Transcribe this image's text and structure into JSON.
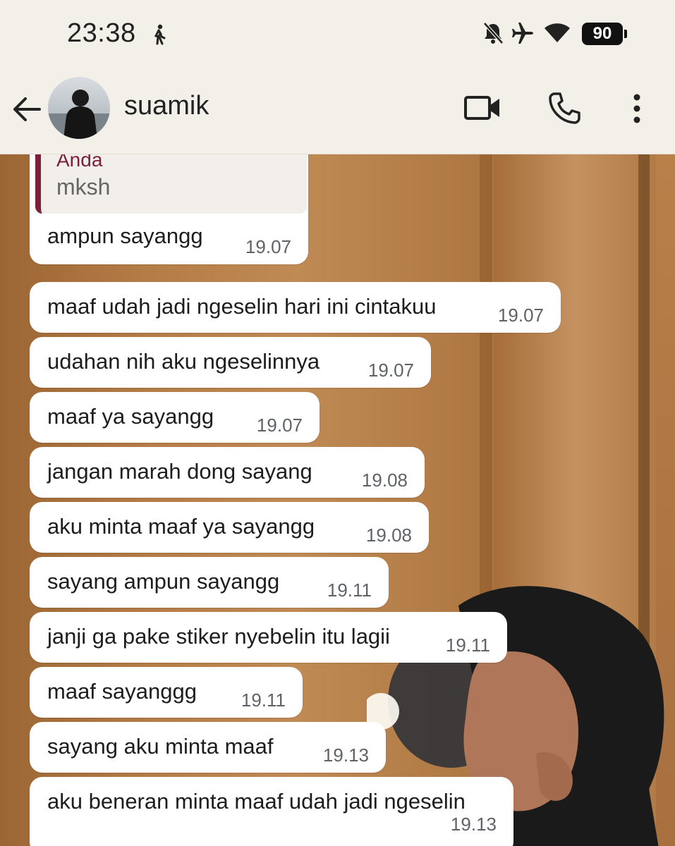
{
  "status_bar": {
    "time": "23:38",
    "battery": "90"
  },
  "header": {
    "contact_name": "suamik"
  },
  "reply_quote": {
    "author": "Anda",
    "text": "mksh"
  },
  "messages": [
    {
      "text": "ampun sayangg",
      "time": "19.07"
    },
    {
      "text": "maaf udah jadi ngeselin hari ini cintakuu",
      "time": "19.07"
    },
    {
      "text": "udahan nih aku ngeselinnya",
      "time": "19.07"
    },
    {
      "text": "maaf ya sayangg",
      "time": "19.07"
    },
    {
      "text": "jangan marah dong sayang",
      "time": "19.08"
    },
    {
      "text": "aku minta maaf ya sayangg",
      "time": "19.08"
    },
    {
      "text": "sayang ampun sayangg",
      "time": "19.11"
    },
    {
      "text": "janji ga pake stiker nyebelin itu lagii",
      "time": "19.11"
    },
    {
      "text": "maaf sayanggg",
      "time": "19.11"
    },
    {
      "text": "sayang aku minta maaf",
      "time": "19.13"
    },
    {
      "text": "aku beneran minta maaf udah jadi ngeselin",
      "time": "19.13"
    }
  ],
  "colors": {
    "quote_accent": "#7b1f3a",
    "bubble": "#ffffff",
    "header_bg": "#f3f0ea"
  }
}
